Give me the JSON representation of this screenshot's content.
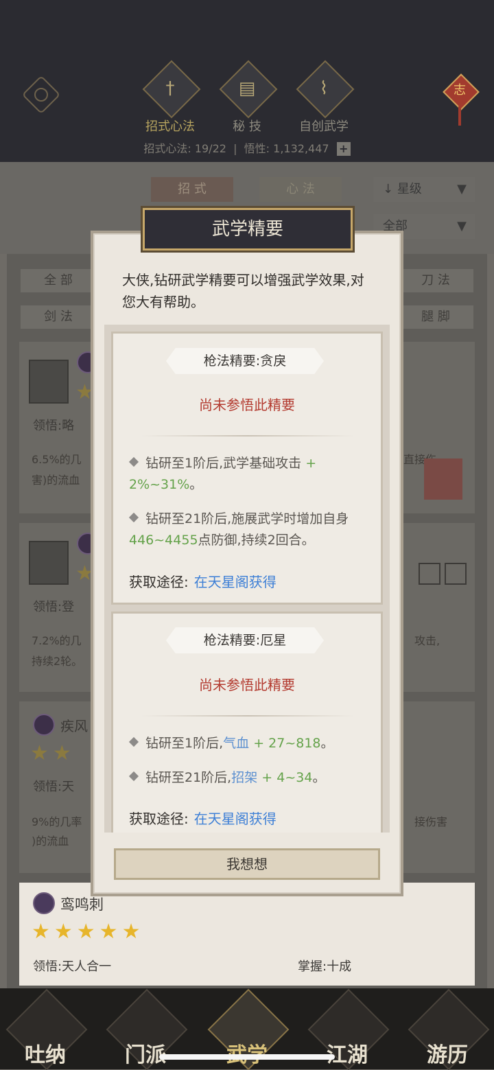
{
  "top": {
    "tabs": [
      {
        "label": "招式心法",
        "icon": "sword-icon"
      },
      {
        "label": "秘 技",
        "icon": "book-icon"
      },
      {
        "label": "自创武学",
        "icon": "scroll-icon"
      }
    ],
    "stats": {
      "label1": "招式心法:",
      "value1": "19/22",
      "label2": "悟性:",
      "value2": "1,132,447",
      "plus": "+"
    },
    "charm_text": "志"
  },
  "filters": {
    "tab_moves": "招 式",
    "tab_skills": "心 法",
    "sort_select": "星级",
    "filter_select": "全部",
    "pills": [
      "全 部",
      "刀 法",
      "剑 法",
      "腿 脚"
    ]
  },
  "list": {
    "card1": {
      "comprehend": "领悟:略",
      "desc_left": "6.5%的几",
      "desc_left2": "害)的流血",
      "desc_right": "直接伤"
    },
    "card2": {
      "comprehend": "领悟:登",
      "desc_left": "7.2%的几",
      "desc_left2": "持续2轮。",
      "desc_right": "攻击,"
    },
    "card3": {
      "name": "疾风",
      "comprehend": "领悟:天",
      "desc_left": "9%的几率",
      "desc_left2": ")的流血",
      "desc_right": "接伤害"
    },
    "card4": {
      "name": "鸾鸣刺",
      "stars": "★★★★★",
      "comprehend": "领悟:天人合一",
      "mastery": "掌握:十成"
    }
  },
  "bottom_nav": [
    "吐纳",
    "门派",
    "武学",
    "江湖",
    "游历"
  ],
  "modal": {
    "title": "武学精要",
    "intro": "大侠,钻研武学精要可以增强武学效果,对您大有帮助。",
    "entries": [
      {
        "caption": "枪法精要:贪戾",
        "status": "尚未参悟此精要",
        "effects": [
          {
            "prefix": "钻研至1阶后,武学基础攻击",
            "stat": "",
            "value": "+ 2%~31%",
            "suffix": "。"
          },
          {
            "prefix": "钻研至21阶后,施展武学时增加自身",
            "stat": "",
            "value": "446~4455",
            "suffix": "点防御,持续2回合。"
          }
        ],
        "route_label": "获取途径:",
        "route_link": "在天星阁获得"
      },
      {
        "caption": "枪法精要:厄星",
        "status": "尚未参悟此精要",
        "effects": [
          {
            "prefix": "钻研至1阶后,",
            "stat": "气血",
            "value": "+ 27~818",
            "suffix": "。"
          },
          {
            "prefix": "钻研至21阶后,",
            "stat": "招架",
            "value": "+ 4~34",
            "suffix": "。"
          }
        ],
        "route_label": "获取途径:",
        "route_link": "在天星阁获得"
      }
    ],
    "button": "我想想"
  }
}
